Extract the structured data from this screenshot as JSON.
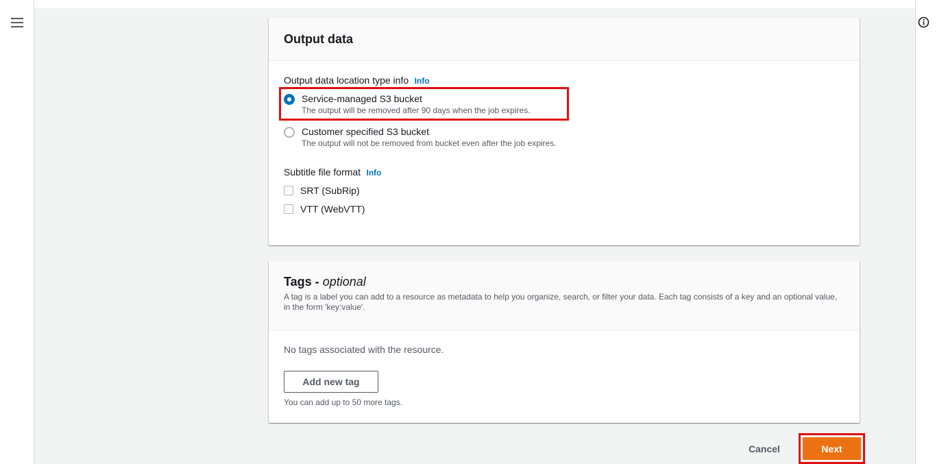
{
  "output_panel": {
    "title": "Output data",
    "location_label": "Output data location type info",
    "location_info": "Info",
    "options": [
      {
        "title": "Service-managed S3 bucket",
        "description": "The output will be removed after 90 days when the job expires.",
        "selected": true
      },
      {
        "title": "Customer specified S3 bucket",
        "description": "The output will not be removed from bucket even after the job expires.",
        "selected": false
      }
    ],
    "subtitle_label": "Subtitle file format",
    "subtitle_info": "Info",
    "formats": [
      {
        "label": "SRT (SubRip)",
        "checked": false
      },
      {
        "label": "VTT (WebVTT)",
        "checked": false
      }
    ]
  },
  "tags_panel": {
    "title": "Tags -",
    "title_optional": "optional",
    "description": "A tag is a label you can add to a resource as metadata to help you organize, search, or filter your data. Each tag consists of a key and an optional value, in the form 'key:value'.",
    "empty_text": "No tags associated with the resource.",
    "add_button": "Add new tag",
    "limit_text": "You can add up to 50 more tags."
  },
  "footer": {
    "cancel_label": "Cancel",
    "next_label": "Next"
  },
  "colors": {
    "primary": "#ec7211",
    "link": "#0073bb",
    "highlight": "#e0100f"
  },
  "icons": [
    "menu-icon",
    "info-icon"
  ]
}
